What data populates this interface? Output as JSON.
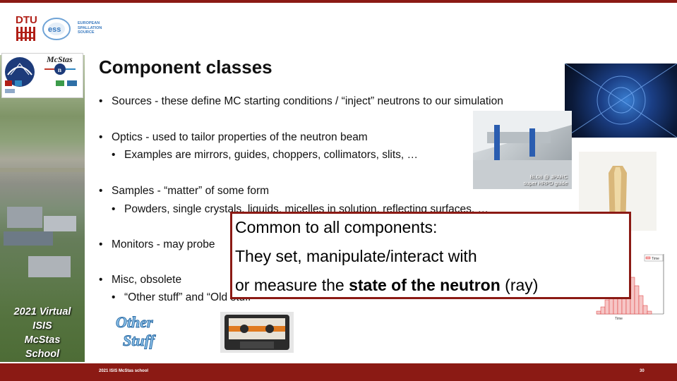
{
  "slide": {
    "title": "Component classes",
    "footer_text": "2021 ISIS McStas school",
    "page_number": "30"
  },
  "logos": {
    "dtu": "DTU",
    "ess_lines": [
      "EUROPEAN",
      "SPALLATION",
      "SOURCE"
    ],
    "mcstas": "McStas"
  },
  "sidebar": {
    "school_lines": [
      "2021 Virtual",
      "ISIS",
      "McStas",
      "School"
    ]
  },
  "bullets": [
    {
      "text": "Sources - these define MC starting conditions / “inject” neutrons to our simulation"
    },
    {
      "text": "Optics - used to tailor properties of the neutron beam"
    },
    {
      "text": "Examples are mirrors, guides, choppers, collimators, slits, …"
    },
    {
      "text": "Samples - “matter” of some form"
    },
    {
      "text": "Powders, single crystals, liquids, micelles in solution, reflecting surfaces, …"
    },
    {
      "text": "Monitors - may probe "
    },
    {
      "text": "Misc, obsolete"
    },
    {
      "text": "“Other stuff” and “Old stuff”"
    }
  ],
  "images": {
    "guide_caption": [
      "BL08 @ JPARC",
      "super HRPD guide"
    ],
    "other_stuff": "Other Stuff",
    "hist_legend": "Time",
    "hist_xlabel": "Time"
  },
  "callout": {
    "line1": "Common to all components:",
    "line2": "They set, manipulate/interact with",
    "line3_pre": "or measure the ",
    "line3_bold": "state of the neutron",
    "line3_post": " (ray)"
  },
  "colors": {
    "brand_red": "#8b1a14",
    "ess_blue": "#3a7abf"
  }
}
